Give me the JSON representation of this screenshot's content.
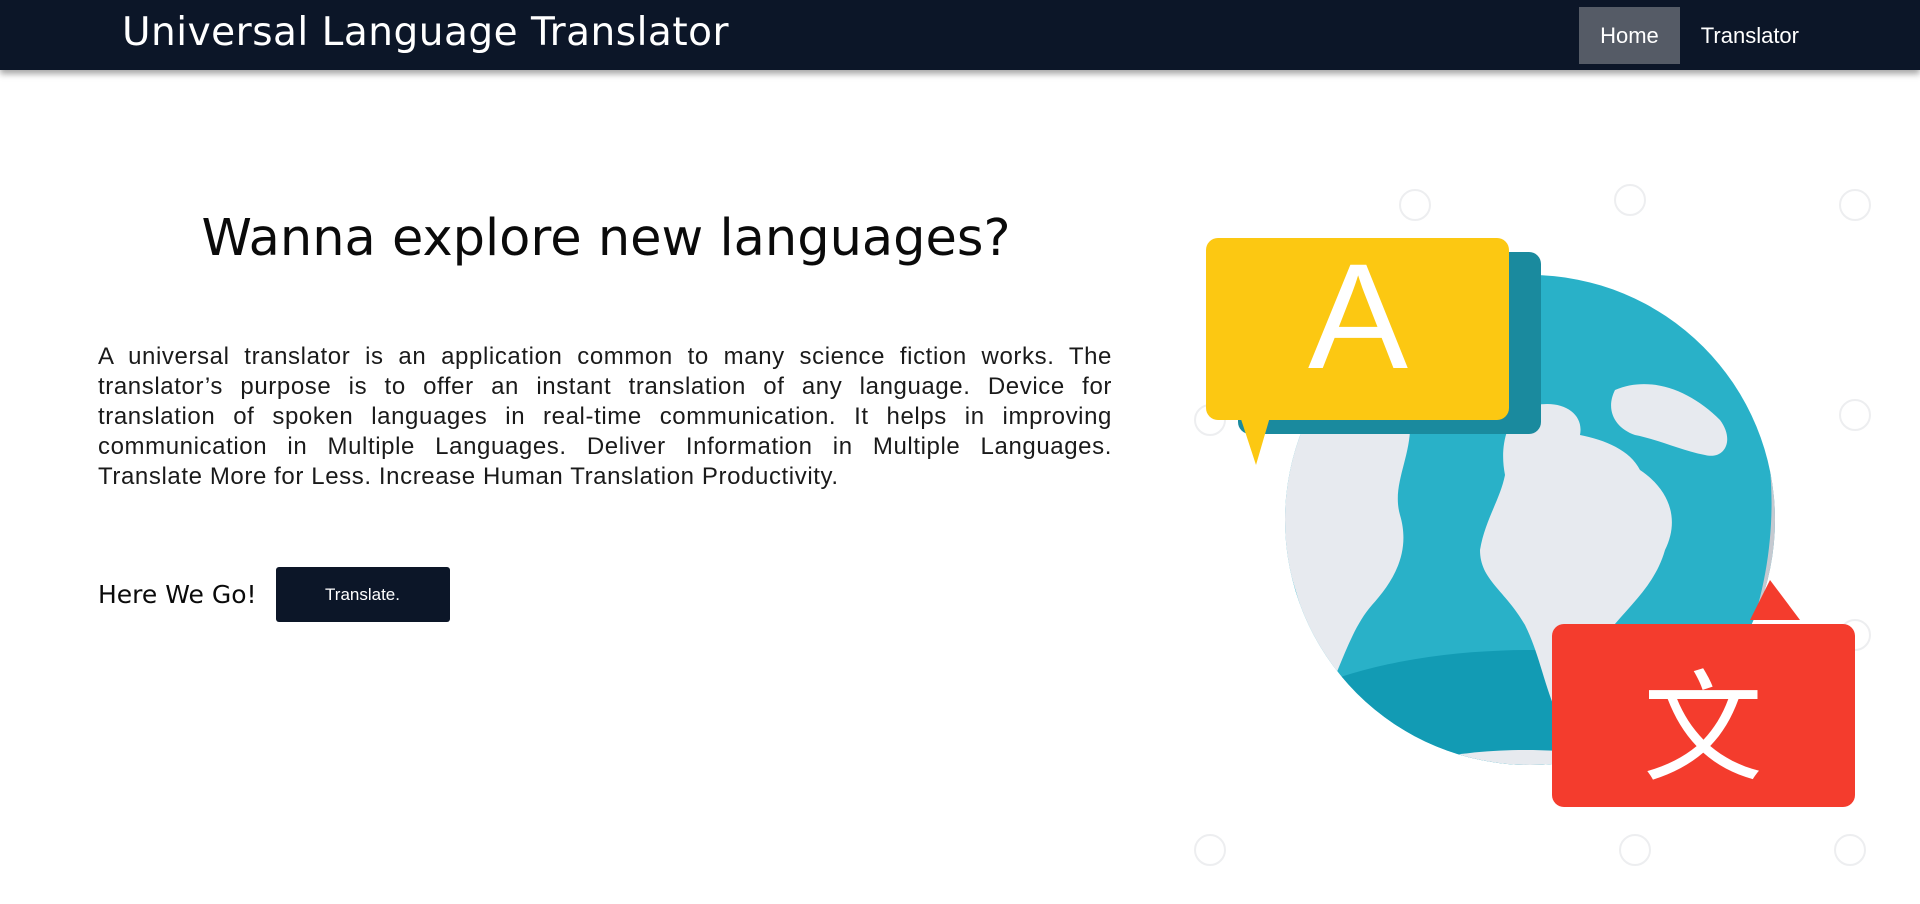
{
  "navbar": {
    "brand": "Universal Language Translator",
    "links": [
      {
        "label": "Home",
        "active": true
      },
      {
        "label": "Translator",
        "active": false
      }
    ],
    "background": "#0c1628",
    "active_background": "#555b66"
  },
  "hero": {
    "title": "Wanna explore new languages?",
    "description": "A universal translator is an application common to many science fiction works. The translator’s purpose is to offer an instant translation of any language. Device for translation of spoken languages in real-time communication. It helps in improving communication in Multiple Languages. Deliver Information in Multiple Languages. Translate More for Less. Increase Human Translation Productivity.",
    "cta_label": "Here We Go!",
    "cta_button": "Translate."
  },
  "illustration": {
    "bubble_left_glyph": "A",
    "bubble_right_glyph": "文",
    "colors": {
      "ocean": "#29b1c8",
      "ocean_dark": "#129bb4",
      "land": "#e7eaef",
      "shade": "#c5c9d0",
      "yellow_bubble": "#fcc812",
      "red_bubble": "#f43c2d"
    },
    "icons": [
      "globe-icon",
      "speech-bubble-icon",
      "speech-bubble-icon"
    ]
  }
}
